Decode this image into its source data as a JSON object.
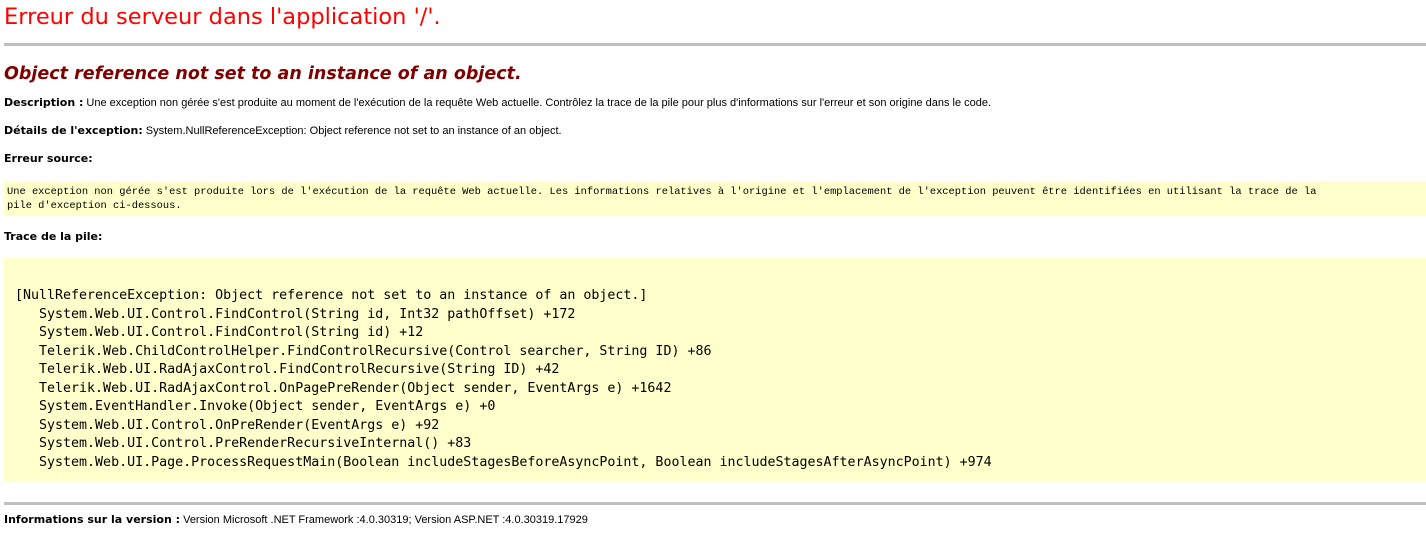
{
  "page": {
    "title": "Erreur du serveur dans l'application '/'.",
    "subtitle": "Object reference not set to an instance of an object.",
    "description": {
      "label": "Description :",
      "text": " Une exception non gérée s'est produite au moment de l'exécution de la requête Web actuelle. Contrôlez la trace de la pile pour plus d'informations sur l'erreur et son origine dans le code."
    },
    "exception_details": {
      "label": "Détails de l'exception:",
      "text": " System.NullReferenceException: Object reference not set to an instance of an object."
    },
    "source_error": {
      "label": "Erreur source:",
      "lines": [
        "Une exception non gérée s'est produite lors de l'exécution de la requête Web actuelle. Les informations relatives à l'origine et l'emplacement de l'exception peuvent être identifiées en utilisant la trace de la",
        "pile d'exception ci-dessous."
      ]
    },
    "stack_trace": {
      "label": "Trace de la pile:",
      "lines": [
        "[NullReferenceException: Object reference not set to an instance of an object.]",
        "   System.Web.UI.Control.FindControl(String id, Int32 pathOffset) +172",
        "   System.Web.UI.Control.FindControl(String id) +12",
        "   Telerik.Web.ChildControlHelper.FindControlRecursive(Control searcher, String ID) +86",
        "   Telerik.Web.UI.RadAjaxControl.FindControlRecursive(String ID) +42",
        "   Telerik.Web.UI.RadAjaxControl.OnPagePreRender(Object sender, EventArgs e) +1642",
        "   System.EventHandler.Invoke(Object sender, EventArgs e) +0",
        "   System.Web.UI.Control.OnPreRender(EventArgs e) +92",
        "   System.Web.UI.Control.PreRenderRecursiveInternal() +83",
        "   System.Web.UI.Page.ProcessRequestMain(Boolean includeStagesBeforeAsyncPoint, Boolean includeStagesAfterAsyncPoint) +974"
      ]
    },
    "version_info": {
      "label": "Informations sur la version :",
      "text": " Version Microsoft .NET Framework :4.0.30319; Version ASP.NET :4.0.30319.17929"
    }
  },
  "colors": {
    "title": "#ff0000",
    "subtitle": "#800000",
    "code_background": "#ffffcc",
    "rule": "#c0c0c0"
  }
}
